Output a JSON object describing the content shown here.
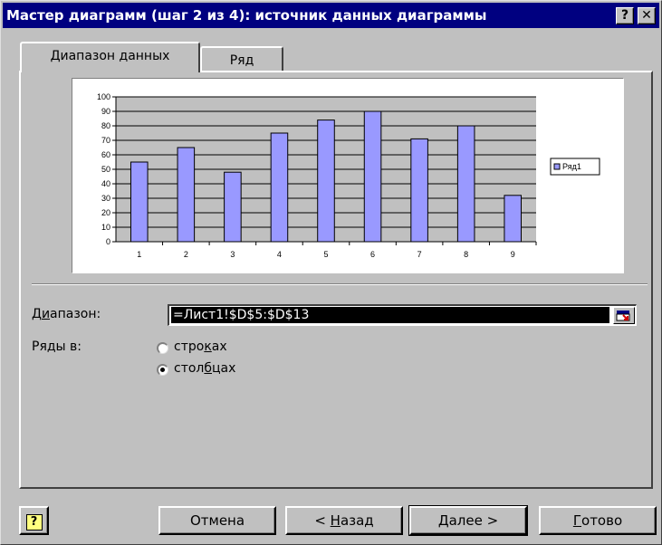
{
  "window": {
    "title": "Мастер диаграмм (шаг 2 из 4): источник данных диаграммы",
    "help_glyph": "?",
    "close_glyph": "✕"
  },
  "tabs": [
    {
      "label": "Диапазон данных",
      "active": true
    },
    {
      "label": "Ряд",
      "active": false
    }
  ],
  "chart_data": {
    "type": "bar",
    "categories": [
      "1",
      "2",
      "3",
      "4",
      "5",
      "6",
      "7",
      "8",
      "9"
    ],
    "series": [
      {
        "name": "Ряд1",
        "values": [
          55,
          65,
          48,
          75,
          84,
          90,
          71,
          80,
          32
        ],
        "color": "#9999ff"
      }
    ],
    "ylim": [
      0,
      100
    ],
    "yticks": [
      0,
      10,
      20,
      30,
      40,
      50,
      60,
      70,
      80,
      90,
      100
    ],
    "grid": true,
    "legend": "right"
  },
  "range": {
    "label_pre": "Д",
    "label_ul": "и",
    "label_post": "апазон:",
    "value": "=Лист1!$D$5:$D$13"
  },
  "series_in": {
    "label": "Ряды в:",
    "rows_pre": "стро",
    "rows_ul": "к",
    "rows_post": "ах",
    "rows_selected": false,
    "cols_pre": "стол",
    "cols_ul": "б",
    "cols_post": "цах",
    "cols_selected": true
  },
  "buttons": {
    "help": "?",
    "cancel": "Отмена",
    "back_pre": "< ",
    "back_ul": "Н",
    "back_post": "азад",
    "next": "Далее >",
    "finish_ul": "Г",
    "finish_post": "отово"
  }
}
